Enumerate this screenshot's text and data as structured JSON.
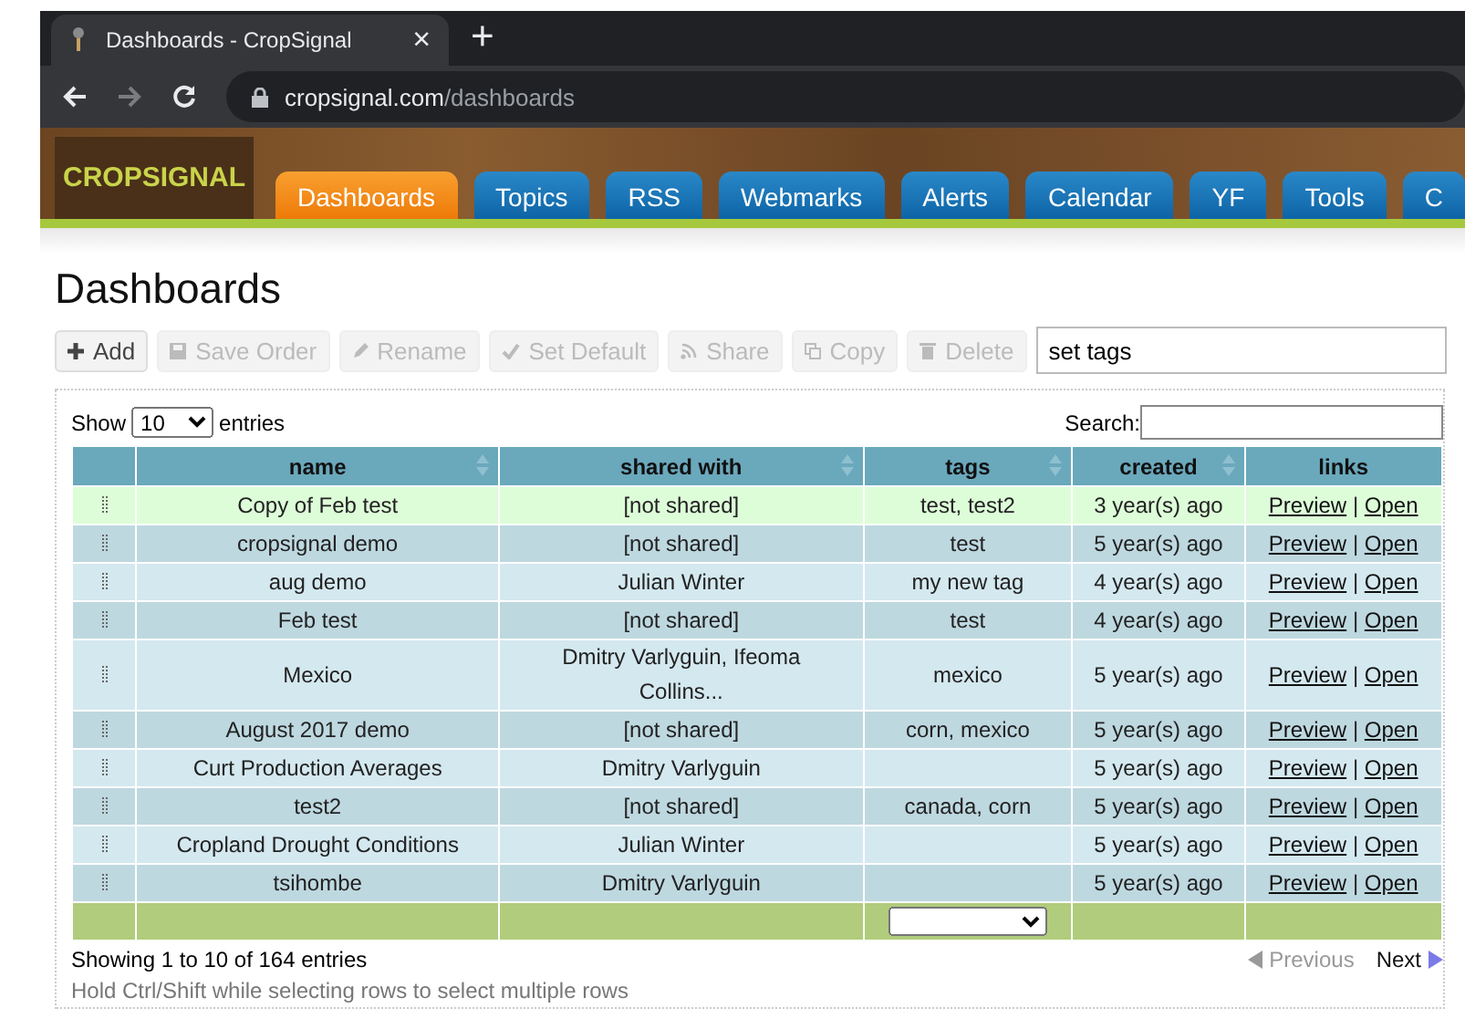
{
  "browser": {
    "tab_title": "Dashboards - CropSignal",
    "tab_close": "×",
    "new_tab": "+",
    "url_host": "cropsignal.com",
    "url_path": "/dashboards"
  },
  "site": {
    "logo": "CROPSIGNAL",
    "nav": [
      {
        "label": "Dashboards",
        "selected": true
      },
      {
        "label": "Topics",
        "selected": false
      },
      {
        "label": "RSS",
        "selected": false
      },
      {
        "label": "Webmarks",
        "selected": false
      },
      {
        "label": "Alerts",
        "selected": false
      },
      {
        "label": "Calendar",
        "selected": false
      },
      {
        "label": "YF",
        "selected": false
      },
      {
        "label": "Tools",
        "selected": false
      },
      {
        "label": "C",
        "selected": false
      }
    ]
  },
  "page_title": "Dashboards",
  "toolbar": [
    {
      "label": "Add",
      "kind": "plus",
      "disabled": false
    },
    {
      "label": "Save Order",
      "kind": "save",
      "disabled": true
    },
    {
      "label": "Rename",
      "kind": "pencil",
      "disabled": true
    },
    {
      "label": "Set Default",
      "kind": "check",
      "disabled": true
    },
    {
      "label": "Share",
      "kind": "feed",
      "disabled": true
    },
    {
      "label": "Copy",
      "kind": "copy",
      "disabled": true
    },
    {
      "label": "Delete",
      "kind": "trash",
      "disabled": true
    }
  ],
  "tags_field": {
    "value": "set tags"
  },
  "length": {
    "before": "Show",
    "value": "10",
    "after": "entries"
  },
  "search": {
    "label": "Search:"
  },
  "table": {
    "columns": [
      "name",
      "shared with",
      "tags",
      "created",
      "links"
    ],
    "rows": [
      {
        "name": "Copy of Feb test",
        "shared_with": "[not shared]",
        "tags": "test, test2",
        "created": "3 year(s) ago",
        "preview": "Preview",
        "open": "Open",
        "selected": true
      },
      {
        "name": "cropsignal demo",
        "shared_with": "[not shared]",
        "tags": "test",
        "created": "5 year(s) ago",
        "preview": "Preview",
        "open": "Open",
        "selected": false
      },
      {
        "name": "aug demo",
        "shared_with": "Julian Winter",
        "tags": "my new tag",
        "created": "4 year(s) ago",
        "preview": "Preview",
        "open": "Open",
        "selected": false
      },
      {
        "name": "Feb test",
        "shared_with": "[not shared]",
        "tags": "test",
        "created": "4 year(s) ago",
        "preview": "Preview",
        "open": "Open",
        "selected": false
      },
      {
        "name": "Mexico",
        "shared_with": "Dmitry Varlyguin, Ifeoma Collins...",
        "tags": "mexico",
        "created": "5 year(s) ago",
        "preview": "Preview",
        "open": "Open",
        "selected": false
      },
      {
        "name": "August 2017 demo",
        "shared_with": "[not shared]",
        "tags": "corn, mexico",
        "created": "5 year(s) ago",
        "preview": "Preview",
        "open": "Open",
        "selected": false
      },
      {
        "name": "Curt Production Averages",
        "shared_with": "Dmitry Varlyguin",
        "created": "5 year(s) ago",
        "preview": "Preview",
        "open": "Open",
        "selected": false
      },
      {
        "name": "test2",
        "shared_with": "[not shared]",
        "tags": "canada, corn",
        "created": "5 year(s) ago",
        "preview": "Preview",
        "open": "Open",
        "selected": false
      },
      {
        "name": "Cropland Drought Conditions",
        "shared_with": "Julian Winter",
        "created": "5 year(s) ago",
        "preview": "Preview",
        "open": "Open",
        "selected": false
      },
      {
        "name": "tsihombe",
        "shared_with": "Dmitry Varlyguin",
        "created": "5 year(s) ago",
        "preview": "Preview",
        "open": "Open",
        "selected": false
      }
    ],
    "link_separator": "|"
  },
  "info": "Showing 1 to 10 of 164 entries",
  "pager": {
    "previous": "Previous",
    "previous_disabled": true,
    "next": "Next",
    "next_disabled": false
  },
  "hint": "Hold Ctrl/Shift while selecting rows to select multiple rows"
}
